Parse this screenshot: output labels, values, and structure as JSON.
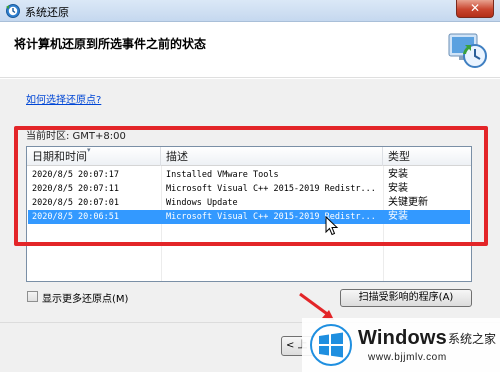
{
  "window": {
    "title": "系统还原",
    "close_label": "✕"
  },
  "header": {
    "title": "将计算机还原到所选事件之前的状态"
  },
  "help_link": "如何选择还原点?",
  "timezone": "当前时区: GMT+8:00",
  "table": {
    "columns": [
      "日期和时间",
      "描述",
      "类型"
    ],
    "rows": [
      {
        "date": "2020/8/5 20:07:17",
        "desc": "Installed VMware Tools",
        "type": "安装",
        "selected": false
      },
      {
        "date": "2020/8/5 20:07:11",
        "desc": "Microsoft Visual C++ 2015-2019 Redistr...",
        "type": "安装",
        "selected": false
      },
      {
        "date": "2020/8/5 20:07:01",
        "desc": "Windows Update",
        "type": "关键更新",
        "selected": false
      },
      {
        "date": "2020/8/5 20:06:51",
        "desc": "Microsoft Visual C++ 2015-2019 Redistr...",
        "type": "安装",
        "selected": true
      }
    ]
  },
  "show_more": {
    "label": "显示更多还原点(M)",
    "checked": false
  },
  "scan_button": "扫描受影响的程序(A)",
  "back_button": "< 上",
  "watermark": {
    "brand": "Windows",
    "cn": "系统之家",
    "url": "www.bjjmlv.com"
  },
  "colors": {
    "highlight_box": "#e32528",
    "selection": "#3399ff",
    "link": "#0046d5"
  },
  "icons": [
    "system-restore-icon",
    "close-icon",
    "restore-clock-icon",
    "mouse-cursor-icon",
    "windows-logo-icon",
    "red-arrow-icon"
  ]
}
